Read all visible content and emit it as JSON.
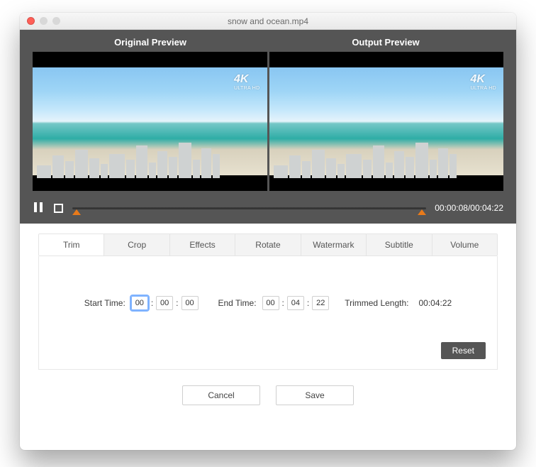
{
  "window": {
    "title": "snow and  ocean.mp4"
  },
  "previews": {
    "original_label": "Original Preview",
    "output_label": "Output  Preview",
    "badge": "4K",
    "badge_sub": "ULTRA HD"
  },
  "playback": {
    "current": "00:00:08",
    "total": "00:04:22",
    "separator": "/"
  },
  "tabs": [
    {
      "id": "trim",
      "label": "Trim",
      "active": true
    },
    {
      "id": "crop",
      "label": "Crop",
      "active": false
    },
    {
      "id": "effects",
      "label": "Effects",
      "active": false
    },
    {
      "id": "rotate",
      "label": "Rotate",
      "active": false
    },
    {
      "id": "watermark",
      "label": "Watermark",
      "active": false
    },
    {
      "id": "subtitle",
      "label": "Subtitle",
      "active": false
    },
    {
      "id": "volume",
      "label": "Volume",
      "active": false
    }
  ],
  "trim": {
    "start_label": "Start Time:",
    "start": {
      "hh": "00",
      "mm": "00",
      "ss": "00"
    },
    "end_label": "End Time:",
    "end": {
      "hh": "00",
      "mm": "04",
      "ss": "22"
    },
    "trimmed_label": "Trimmed Length:",
    "trimmed_value": "00:04:22"
  },
  "buttons": {
    "reset": "Reset",
    "cancel": "Cancel",
    "save": "Save"
  },
  "timeline": {
    "handle_left_percent": 1,
    "handle_right_percent": 99
  }
}
